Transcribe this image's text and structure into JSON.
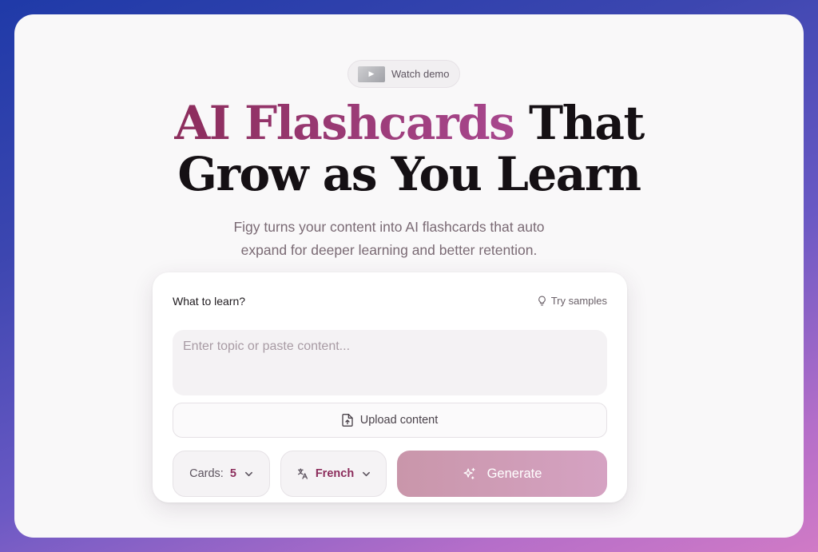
{
  "demo": {
    "label": "Watch demo"
  },
  "hero": {
    "title_accent": "AI Flashcards",
    "title_rest_line1": " That",
    "title_line2": "Grow as You Learn",
    "subtitle": "Figy turns your content into AI flashcards that auto expand for deeper learning and better retention."
  },
  "form": {
    "label": "What to learn?",
    "samples_label": "Try samples",
    "input_placeholder": "Enter topic or paste content...",
    "input_value": "",
    "upload_label": "Upload content",
    "cards_label": "Cards:",
    "cards_value": "5",
    "language_value": "French",
    "generate_label": "Generate"
  },
  "colors": {
    "accent": "#8c2d5c",
    "generate_bg": "#cf9db6"
  }
}
